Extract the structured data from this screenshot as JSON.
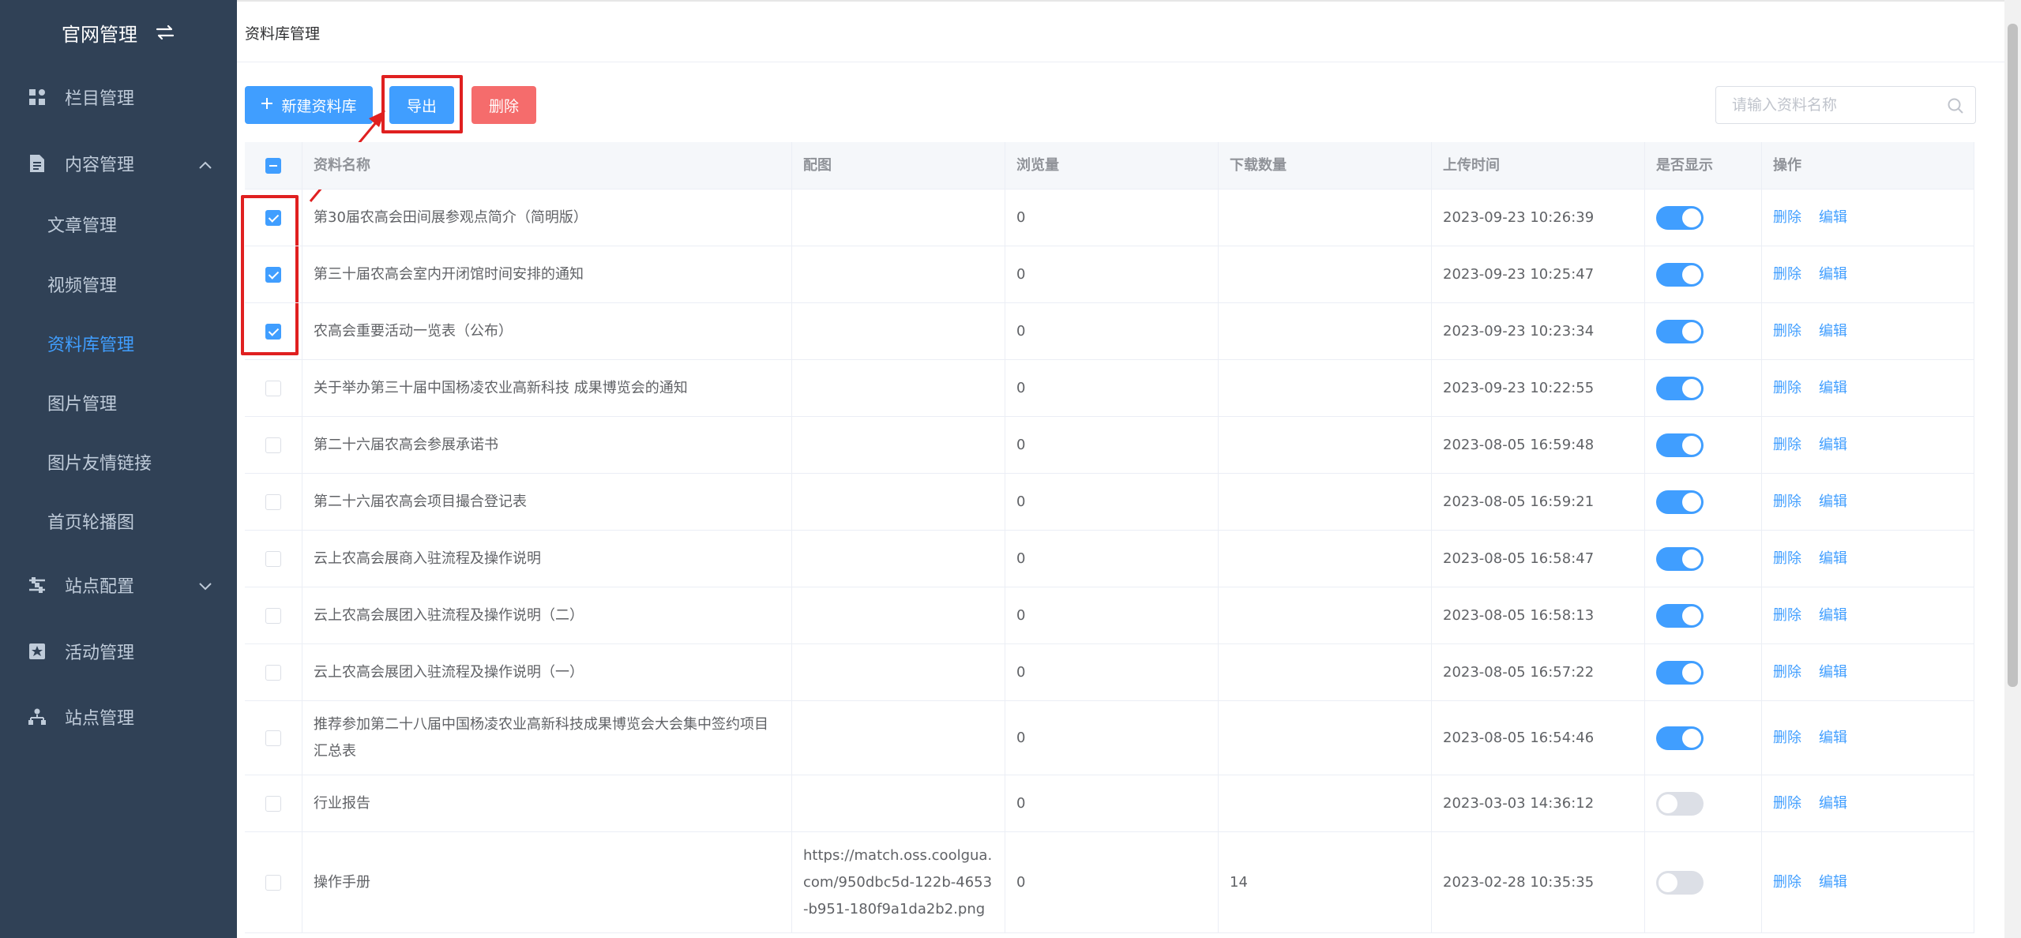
{
  "sidebar": {
    "brand": "官网管理",
    "menu": [
      {
        "label": "栏目管理",
        "icon": "grid-icon"
      },
      {
        "label": "内容管理",
        "icon": "document-icon"
      },
      {
        "label": "站点配置",
        "icon": "settings-icon"
      },
      {
        "label": "活动管理",
        "icon": "star-box-icon"
      },
      {
        "label": "站点管理",
        "icon": "sitemap-icon"
      }
    ],
    "submenu": [
      "文章管理",
      "视频管理",
      "资料库管理",
      "图片管理",
      "图片友情链接",
      "首页轮播图"
    ]
  },
  "breadcrumb": "资料库管理",
  "toolbar": {
    "new_label": "新建资料库",
    "export_label": "导出",
    "delete_label": "删除"
  },
  "search": {
    "placeholder": "请输入资料名称"
  },
  "table": {
    "headers": [
      "资料名称",
      "配图",
      "浏览量",
      "下载数量",
      "上传时间",
      "是否显示",
      "操作"
    ],
    "rows": [
      {
        "name": "第30届农高会田间展参观点简介（简明版）",
        "image": "",
        "views": "0",
        "downloads": "",
        "time": "2023-09-23 10:26:39",
        "show": true,
        "checked": true
      },
      {
        "name": "第三十届农高会室内开闭馆时间安排的通知",
        "image": "",
        "views": "0",
        "downloads": "",
        "time": "2023-09-23 10:25:47",
        "show": true,
        "checked": true
      },
      {
        "name": "农高会重要活动一览表（公布）",
        "image": "",
        "views": "0",
        "downloads": "",
        "time": "2023-09-23 10:23:34",
        "show": true,
        "checked": true
      },
      {
        "name": "关于举办第三十届中国杨凌农业高新科技 成果博览会的通知",
        "image": "",
        "views": "0",
        "downloads": "",
        "time": "2023-09-23 10:22:55",
        "show": true,
        "checked": false
      },
      {
        "name": "第二十六届农高会参展承诺书",
        "image": "",
        "views": "0",
        "downloads": "",
        "time": "2023-08-05 16:59:48",
        "show": true,
        "checked": false
      },
      {
        "name": "第二十六届农高会项目撮合登记表",
        "image": "",
        "views": "0",
        "downloads": "",
        "time": "2023-08-05 16:59:21",
        "show": true,
        "checked": false
      },
      {
        "name": "云上农高会展商入驻流程及操作说明",
        "image": "",
        "views": "0",
        "downloads": "",
        "time": "2023-08-05 16:58:47",
        "show": true,
        "checked": false
      },
      {
        "name": "云上农高会展团入驻流程及操作说明（二）",
        "image": "",
        "views": "0",
        "downloads": "",
        "time": "2023-08-05 16:58:13",
        "show": true,
        "checked": false
      },
      {
        "name": "云上农高会展团入驻流程及操作说明（一）",
        "image": "",
        "views": "0",
        "downloads": "",
        "time": "2023-08-05 16:57:22",
        "show": true,
        "checked": false
      },
      {
        "name": "推荐参加第二十八届中国杨凌农业高新科技成果博览会大会集中签约项目汇总表",
        "image": "",
        "views": "0",
        "downloads": "",
        "time": "2023-08-05 16:54:46",
        "show": true,
        "checked": false
      },
      {
        "name": "行业报告",
        "image": "",
        "views": "0",
        "downloads": "",
        "time": "2023-03-03 14:36:12",
        "show": false,
        "checked": false
      },
      {
        "name": "操作手册",
        "image": "https://match.oss.coolgua.com/950dbc5d-122b-4653-b951-180f9a1da2b2.png",
        "views": "0",
        "downloads": "14",
        "time": "2023-02-28 10:35:35",
        "show": false,
        "checked": false
      }
    ],
    "actions": {
      "delete": "删除",
      "edit": "编辑"
    }
  },
  "colors": {
    "primary": "#409eff",
    "danger": "#f56c6c",
    "sidebar": "#304156",
    "annotation": "#e02020"
  }
}
